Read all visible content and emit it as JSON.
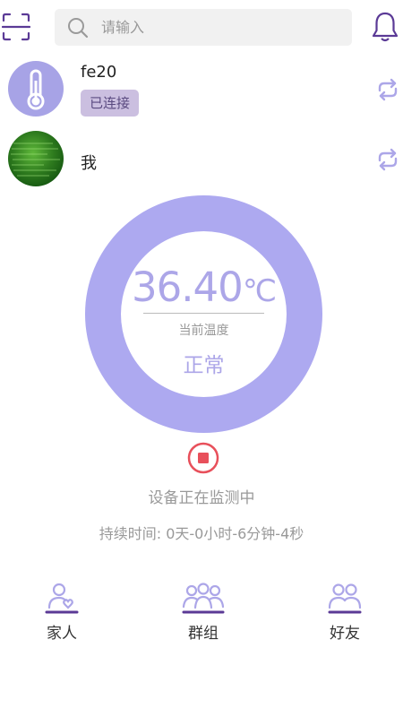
{
  "search": {
    "placeholder": "请输入"
  },
  "devices": [
    {
      "name": "fe20",
      "status": "已连接",
      "avatar": "thermometer-icon"
    },
    {
      "name": "我",
      "avatar": "photo"
    }
  ],
  "gauge": {
    "value": "36.40",
    "unit": "℃",
    "label": "当前温度",
    "status": "正常"
  },
  "monitor": {
    "status_text": "设备正在监测中",
    "duration_text": "持续时间: 0天-0小时-6分钟-4秒"
  },
  "nav": [
    {
      "label": "家人",
      "icon": "family-icon"
    },
    {
      "label": "群组",
      "icon": "group-icon"
    },
    {
      "label": "好友",
      "icon": "friends-icon"
    }
  ],
  "colors": {
    "accent": "#ada9f0",
    "accent_text": "#aca6e8",
    "icon_purple": "#5b3a96",
    "badge_bg": "#cbbfe0",
    "stop_red": "#e8505b"
  }
}
